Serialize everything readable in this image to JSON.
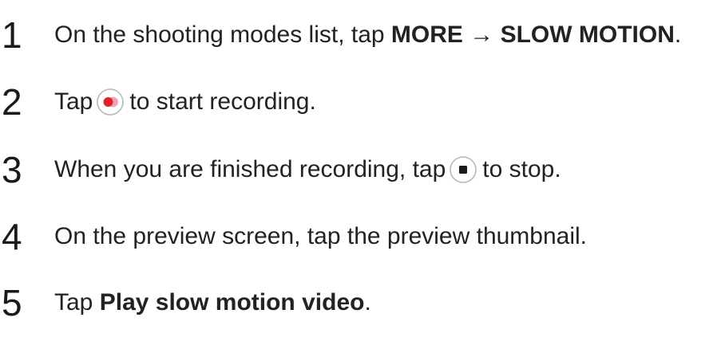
{
  "steps": [
    {
      "number": "1",
      "text_before": "On the shooting modes list, tap ",
      "bold_1": "MORE",
      "arrow": " → ",
      "bold_2": "SLOW MOTION",
      "text_after": "."
    },
    {
      "number": "2",
      "text_before": "Tap",
      "icon": "record-icon",
      "text_after": "to start recording."
    },
    {
      "number": "3",
      "text_before": "When you are finished recording, tap",
      "icon": "stop-icon",
      "text_after": "to stop."
    },
    {
      "number": "4",
      "text": "On the preview screen, tap the preview thumbnail."
    },
    {
      "number": "5",
      "text_before": "Tap ",
      "bold_1": "Play slow motion video",
      "text_after": "."
    }
  ],
  "colors": {
    "record_red": "#e0222c",
    "record_pink": "#f6a3a8",
    "icon_ring": "#b8b8b8",
    "stop_fill": "#1a1a1a"
  }
}
